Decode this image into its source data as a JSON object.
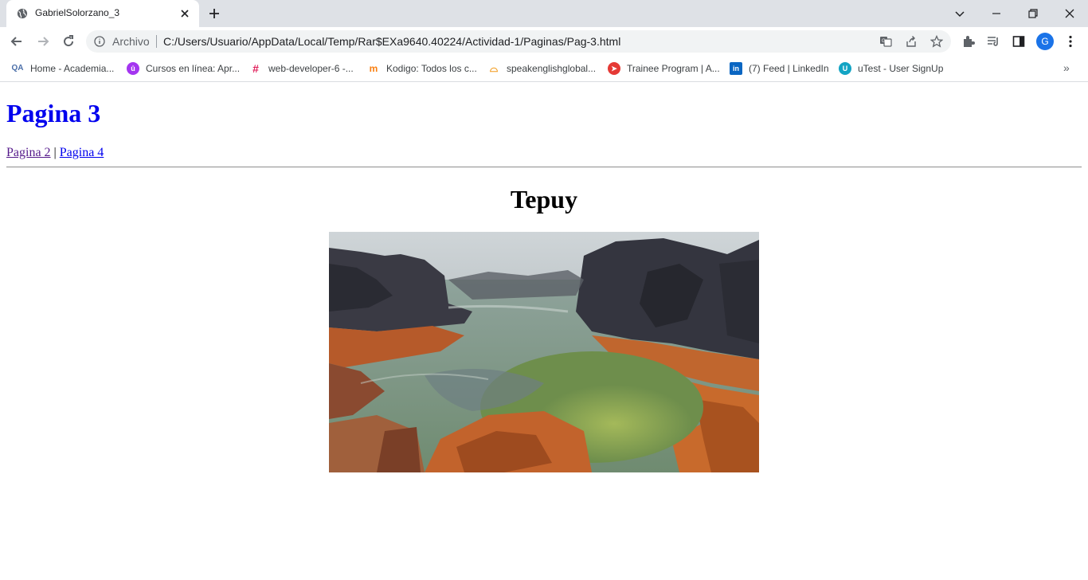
{
  "browser": {
    "tab_title": "GabrielSolorzano_3",
    "address_prefix": "Archivo",
    "url": "C:/Users/Usuario/AppData/Local/Temp/Rar$EXa9640.40224/Actividad-1/Paginas/Pag-3.html",
    "profile_initial": "G",
    "bookmarks": [
      {
        "label": "Home - Academia...",
        "icon": "academia-icon",
        "color": "#4a6ea8"
      },
      {
        "label": "Cursos en línea: Apr...",
        "icon": "udemy-icon",
        "color": "#a435f0"
      },
      {
        "label": "web-developer-6 -...",
        "icon": "slack-icon",
        "color": "#e01e5a"
      },
      {
        "label": "Kodigo: Todos los c...",
        "icon": "moodle-icon",
        "color": "#f98012"
      },
      {
        "label": "speakenglishglobal...",
        "icon": "speak-icon",
        "color": "#f29b1d"
      },
      {
        "label": "Trainee Program | A...",
        "icon": "trainee-icon",
        "color": "#e53935"
      },
      {
        "label": "(7) Feed | LinkedIn",
        "icon": "linkedin-icon",
        "color": "#0a66c2"
      },
      {
        "label": "uTest - User SignUp",
        "icon": "utest-icon",
        "color": "#13a4c4"
      }
    ]
  },
  "page": {
    "heading": "Pagina 3",
    "links": {
      "prev": "Pagina 2",
      "separator": " | ",
      "next": "Pagina 4"
    },
    "subheading": "Tepuy",
    "image_icon": "tepuy-landscape-photo"
  },
  "colors": {
    "heading": "#0000ee",
    "visited_link": "#551a8b",
    "link": "#0000ee"
  }
}
